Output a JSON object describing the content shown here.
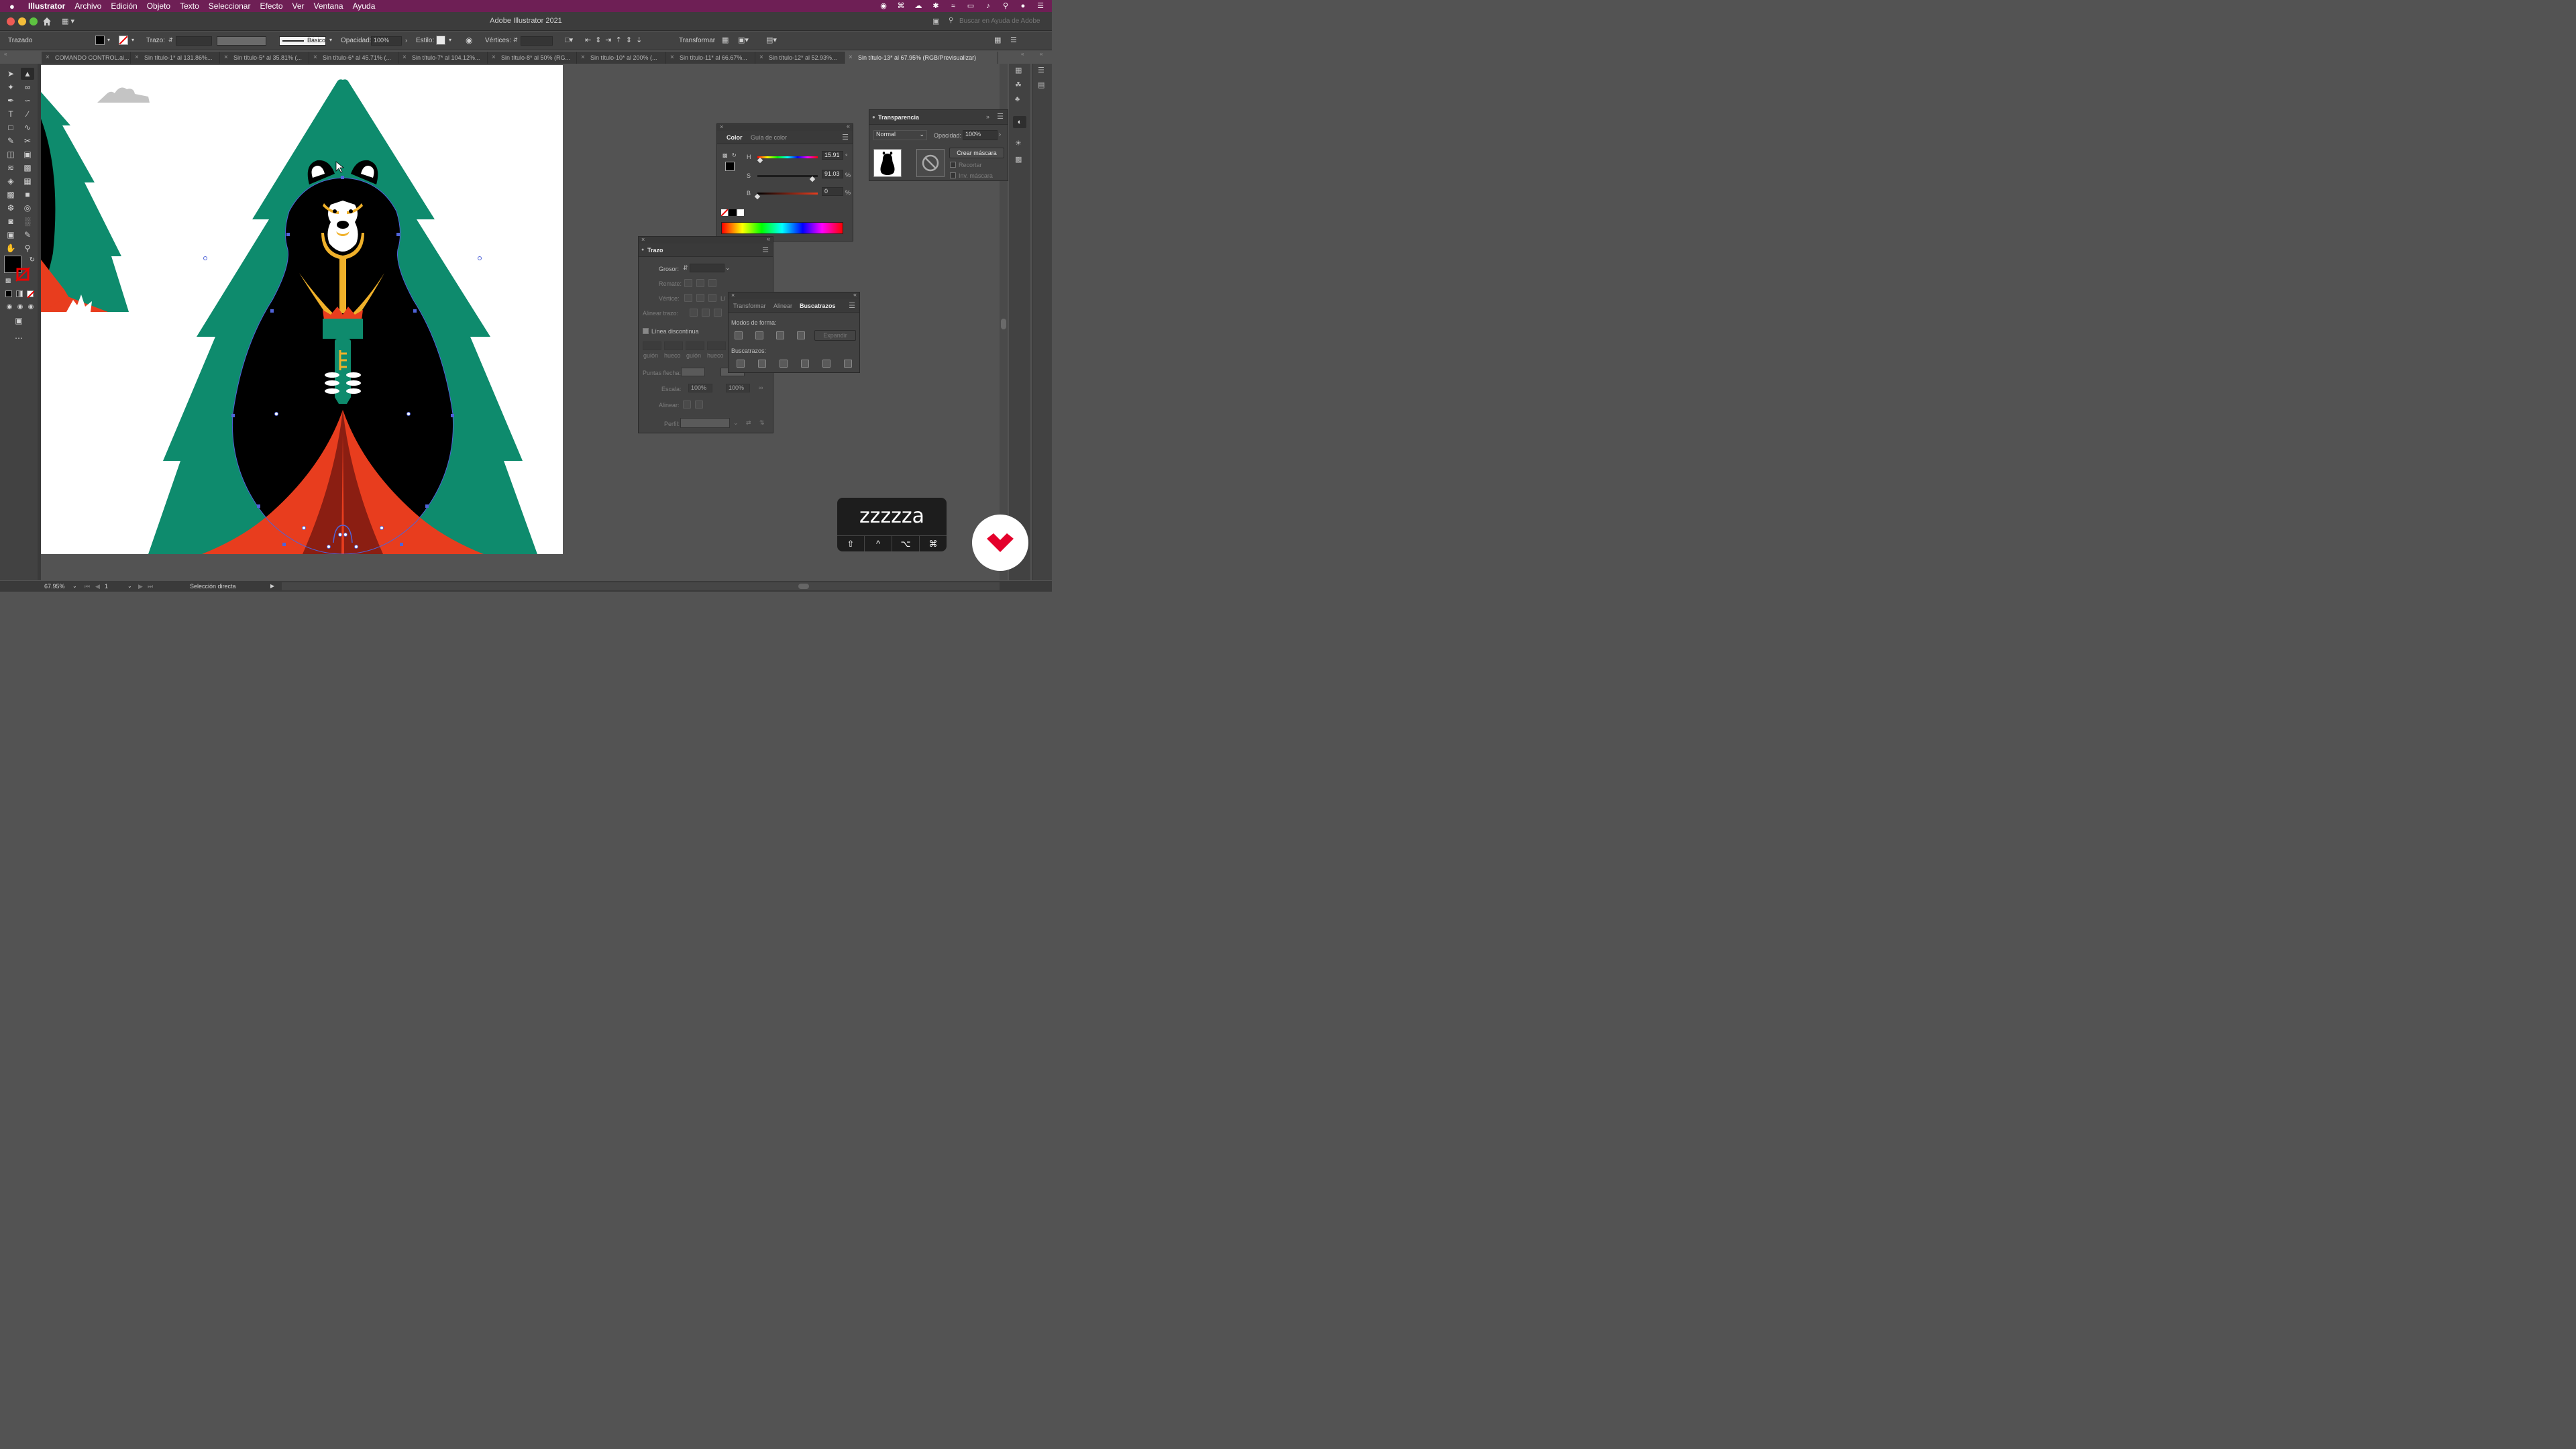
{
  "menubar": {
    "apple": "",
    "app": "Illustrator",
    "items": [
      "Archivo",
      "Edición",
      "Objeto",
      "Texto",
      "Seleccionar",
      "Efecto",
      "Ver",
      "Ventana",
      "Ayuda"
    ]
  },
  "window": {
    "title": "Adobe Illustrator 2021",
    "search_placeholder": "Buscar en Ayuda de Adobe"
  },
  "controlbar": {
    "selection_type": "Trazado",
    "stroke_label": "Trazo:",
    "brush_label": "Básico",
    "opacity_label": "Opacidad:",
    "opacity_value": "100%",
    "style_label": "Estilo:",
    "vertices_label": "Vértices:",
    "transform_label": "Transformar"
  },
  "tabs": [
    {
      "label": "COMANDO CONTROL.ai...",
      "active": false
    },
    {
      "label": "Sin título-1* al 131.86%...",
      "active": false
    },
    {
      "label": "Sin título-5* al 35.81% (...",
      "active": false
    },
    {
      "label": "Sin título-6* al 45.71% (...",
      "active": false
    },
    {
      "label": "Sin título-7* al 104.12%...",
      "active": false
    },
    {
      "label": "Sin título-8* al 50% (RG...",
      "active": false
    },
    {
      "label": "Sin título-10* al 200% (...",
      "active": false
    },
    {
      "label": "Sin título-11* al 66.67%...",
      "active": false
    },
    {
      "label": "Sin título-12* al 52.93%...",
      "active": false
    },
    {
      "label": "Sin título-13* al 67.95% (RGB/Previsualizar)",
      "active": true
    }
  ],
  "color_panel": {
    "tab_color": "Color",
    "tab_guide": "Guía de color",
    "h_label": "H",
    "h_value": "15.91",
    "h_unit": "°",
    "h_fraction": 0.044,
    "s_label": "S",
    "s_value": "91.03",
    "s_unit": "%",
    "s_fraction": 0.91,
    "b_label": "B",
    "b_value": "0",
    "b_unit": "%",
    "b_fraction": 0.0
  },
  "transparency_panel": {
    "title": "Transparencia",
    "blend_mode": "Normal",
    "opacity_label": "Opacidad:",
    "opacity_value": "100%",
    "make_mask_button": "Crear máscara",
    "clip_label": "Recortar",
    "invert_label": "Inv. máscara"
  },
  "stroke_panel": {
    "title": "Trazo",
    "weight_label": "Grosor:",
    "cap_label": "Remate:",
    "corner_label": "Vértice:",
    "align_label": "Alinear trazo:",
    "limit_label": "Lí",
    "dashed_label": "Línea discontinua",
    "dash_fields": [
      "guión",
      "hueco",
      "guión",
      "hueco"
    ],
    "arrowheads_label": "Puntas flecha:",
    "scale_label": "Escala:",
    "scale_value_1": "100%",
    "scale_value_2": "100%",
    "align_label2": "Alinear:",
    "profile_label": "Perfil:"
  },
  "pathfinder_panel": {
    "tab_transform": "Transformar",
    "tab_align": "Alinear",
    "tab_pathfinder": "Buscatrazos",
    "shape_modes_label": "Modos de forma:",
    "expand_button": "Expandir",
    "pathfinders_label": "Buscatrazos:"
  },
  "key_overlay": {
    "text": "zzzzza",
    "modifiers": [
      "⇧",
      "^",
      "⌥",
      "⌘"
    ]
  },
  "statusbar": {
    "zoom": "67.95%",
    "artboard": "1",
    "tool": "Selección directa"
  },
  "colors": {
    "menubar": "#6e1f55",
    "tree_green": "#0e8b6d",
    "bear_black": "#000000",
    "tent_red": "#e83d1e",
    "tent_dark": "#8b1e12",
    "torch_yellow": "#f0b12a",
    "cloud_gray": "#c4c4c4",
    "brand_red": "#e4002b"
  }
}
